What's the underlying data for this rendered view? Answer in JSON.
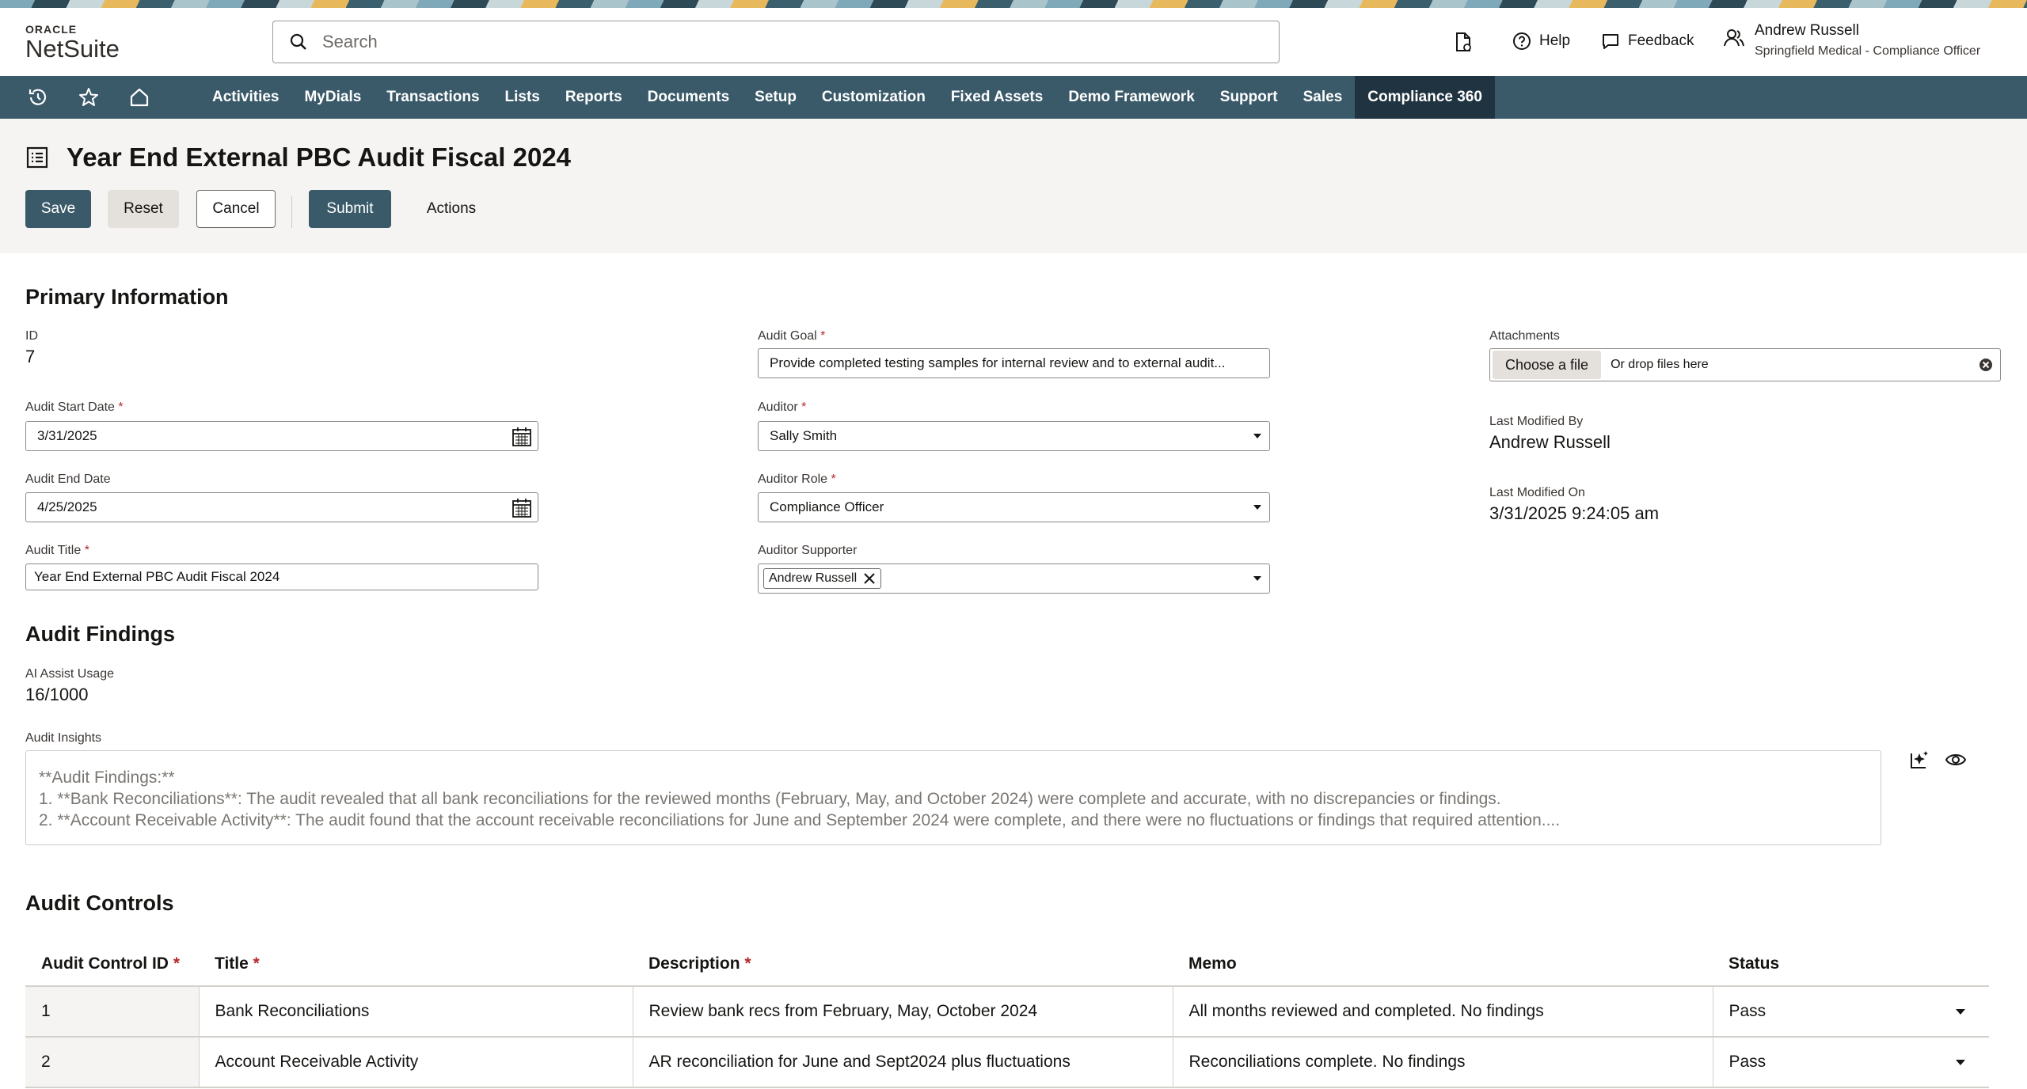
{
  "brand": {
    "oracle": "ORACLE",
    "product": "NetSuite"
  },
  "search": {
    "placeholder": "Search"
  },
  "header": {
    "help": "Help",
    "feedback": "Feedback",
    "user_name": "Andrew Russell",
    "user_role": "Springfield Medical - Compliance Officer"
  },
  "nav": {
    "items": [
      "Activities",
      "MyDials",
      "Transactions",
      "Lists",
      "Reports",
      "Documents",
      "Setup",
      "Customization",
      "Fixed Assets",
      "Demo Framework",
      "Support",
      "Sales",
      "Compliance 360"
    ],
    "active": "Compliance 360"
  },
  "page": {
    "title": "Year End External PBC Audit Fiscal 2024",
    "buttons": {
      "save": "Save",
      "reset": "Reset",
      "cancel": "Cancel",
      "submit": "Submit",
      "actions": "Actions"
    }
  },
  "primary": {
    "heading": "Primary Information",
    "id_label": "ID",
    "id_value": "7",
    "start_label": "Audit Start Date",
    "start_value": "3/31/2025",
    "end_label": "Audit End Date",
    "end_value": "4/25/2025",
    "title_label": "Audit Title",
    "title_value": "Year End External PBC Audit Fiscal 2024",
    "goal_label": "Audit Goal",
    "goal_value": "Provide completed testing samples for internal review and to external audit...",
    "auditor_label": "Auditor",
    "auditor_value": "Sally Smith",
    "role_label": "Auditor Role",
    "role_value": "Compliance Officer",
    "supporter_label": "Auditor Supporter",
    "supporter_value": "Andrew Russell",
    "attach_label": "Attachments",
    "attach_button": "Choose a file",
    "attach_drop": "Or drop files here",
    "modby_label": "Last Modified By",
    "modby_value": "Andrew Russell",
    "modon_label": "Last Modified On",
    "modon_value": "3/31/2025 9:24:05 am"
  },
  "findings": {
    "heading": "Audit Findings",
    "ai_label": "AI Assist Usage",
    "ai_value": "16/1000",
    "insights_label": "Audit Insights",
    "insights_lines": [
      "**Audit Findings:**",
      "1. **Bank Reconciliations**: The audit revealed that all bank reconciliations for the reviewed months (February, May, and October 2024) were complete and accurate, with no discrepancies or findings.",
      "2. **Account Receivable Activity**: The audit found that the account receivable reconciliations for June and September 2024 were complete, and there were no fluctuations or findings that required attention...."
    ]
  },
  "controls": {
    "heading": "Audit Controls",
    "columns": [
      "Audit Control ID",
      "Title",
      "Description",
      "Memo",
      "Status"
    ],
    "rows": [
      [
        "1",
        "Bank Reconciliations",
        "Review bank recs from February, May, October 2024",
        "All months reviewed and completed. No findings",
        "Pass"
      ],
      [
        "2",
        "Account Receivable Activity",
        "AR reconciliation for June and Sept2024 plus fluctuations",
        "Reconciliations complete. No findings",
        "Pass"
      ]
    ]
  },
  "colors": {
    "nav_bg": "#3a5a6a",
    "nav_active": "#1f3440",
    "required": "#b42a2a",
    "page_bg": "#f5f4f2"
  }
}
